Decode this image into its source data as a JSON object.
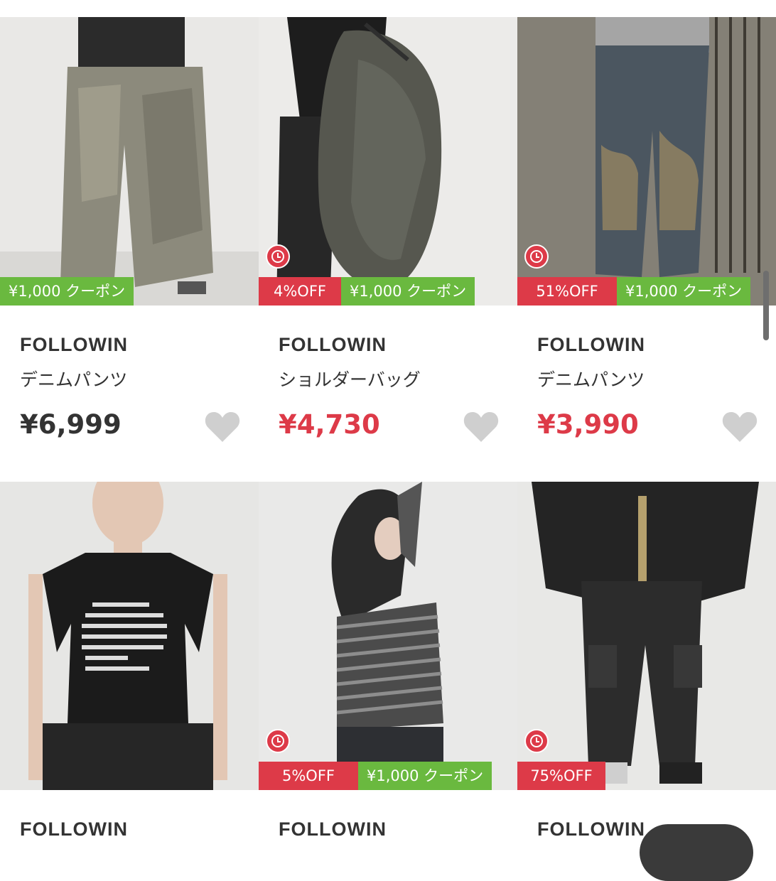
{
  "currency_note": "",
  "colors": {
    "sale_red": "#dd3a48",
    "coupon_green": "#6ab93f",
    "heart_gray": "#cfcfcf"
  },
  "products": [
    {
      "brand": "FOLLOWIN",
      "name": "デニムパンツ",
      "price": "¥6,999",
      "on_sale": false,
      "has_timer": false,
      "discount": "",
      "coupon": "¥1,000 クーポン",
      "favorite_icon": "heart-icon"
    },
    {
      "brand": "FOLLOWIN",
      "name": "ショルダーバッグ",
      "price": "¥4,730",
      "on_sale": true,
      "has_timer": true,
      "discount": "4%OFF",
      "coupon": "¥1,000 クーポン",
      "favorite_icon": "heart-icon"
    },
    {
      "brand": "FOLLOWIN",
      "name": "デニムパンツ",
      "price": "¥3,990",
      "on_sale": true,
      "has_timer": true,
      "discount": "51%OFF",
      "coupon": "¥1,000 クーポン",
      "favorite_icon": "heart-icon"
    },
    {
      "brand": "FOLLOWIN",
      "has_timer": false,
      "discount": "",
      "coupon": ""
    },
    {
      "brand": "FOLLOWIN",
      "has_timer": true,
      "discount": "5%OFF",
      "coupon": "¥1,000 クーポン"
    },
    {
      "brand": "FOLLOWIN",
      "has_timer": true,
      "discount": "75%OFF",
      "coupon": ""
    }
  ]
}
